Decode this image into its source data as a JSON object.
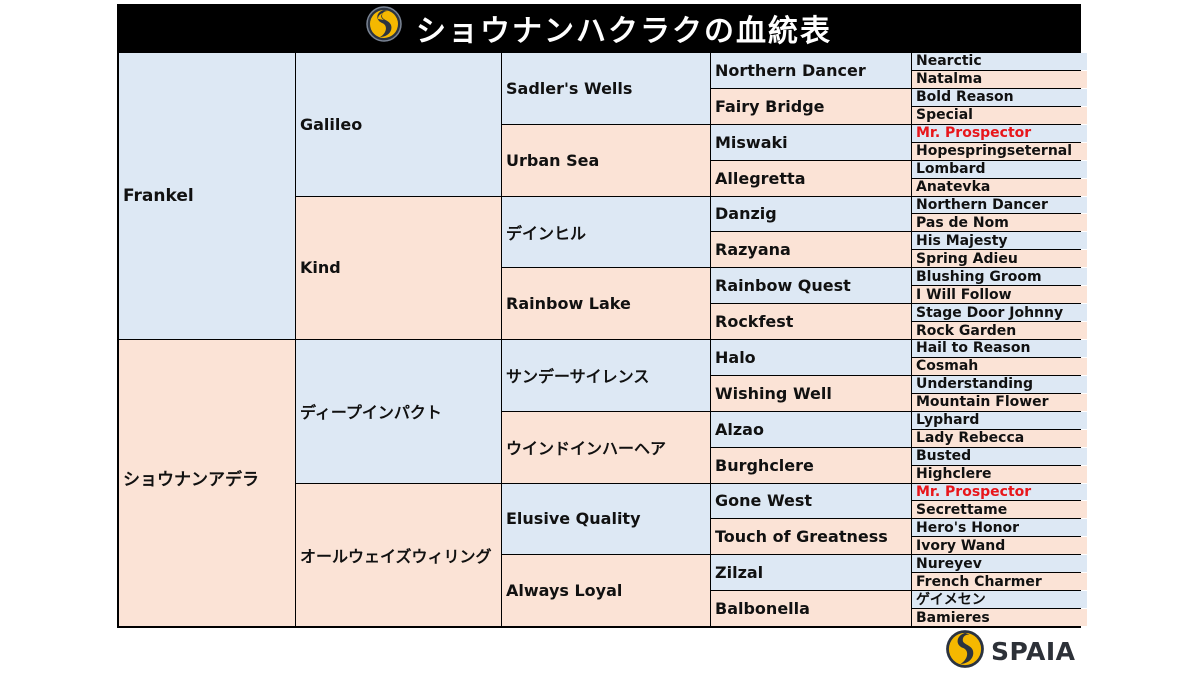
{
  "title": "ショウナンハクラクの血統表",
  "brand": {
    "name": "SPAIA",
    "logo_icon": "spaia-logo-icon"
  },
  "colors": {
    "sire_line": "#dde8f4",
    "dam_line": "#fbe3d6",
    "highlight": "#e8161b",
    "title_bg": "#000000"
  },
  "pedigree": {
    "gen1": [
      {
        "name": "Frankel",
        "side": "sire"
      },
      {
        "name": "ショウナンアデラ",
        "side": "dam"
      }
    ],
    "gen2": [
      {
        "name": "Galileo",
        "side": "sire"
      },
      {
        "name": "Kind",
        "side": "dam"
      },
      {
        "name": "ディープインパクト",
        "side": "sire"
      },
      {
        "name": "オールウェイズウィリング",
        "side": "dam"
      }
    ],
    "gen3": [
      {
        "name": "Sadler's Wells",
        "side": "sire"
      },
      {
        "name": "Urban Sea",
        "side": "dam"
      },
      {
        "name": "デインヒル",
        "side": "sire"
      },
      {
        "name": "Rainbow Lake",
        "side": "dam"
      },
      {
        "name": "サンデーサイレンス",
        "side": "sire"
      },
      {
        "name": "ウインドインハーヘア",
        "side": "dam"
      },
      {
        "name": "Elusive Quality",
        "side": "sire"
      },
      {
        "name": "Always Loyal",
        "side": "dam"
      }
    ],
    "gen4": [
      {
        "name": "Northern Dancer",
        "side": "sire"
      },
      {
        "name": "Fairy Bridge",
        "side": "dam"
      },
      {
        "name": "Miswaki",
        "side": "sire"
      },
      {
        "name": "Allegretta",
        "side": "dam"
      },
      {
        "name": "Danzig",
        "side": "sire"
      },
      {
        "name": "Razyana",
        "side": "dam"
      },
      {
        "name": "Rainbow Quest",
        "side": "sire"
      },
      {
        "name": "Rockfest",
        "side": "dam"
      },
      {
        "name": "Halo",
        "side": "sire"
      },
      {
        "name": "Wishing Well",
        "side": "dam"
      },
      {
        "name": "Alzao",
        "side": "sire"
      },
      {
        "name": "Burghclere",
        "side": "dam"
      },
      {
        "name": "Gone West",
        "side": "sire"
      },
      {
        "name": "Touch of Greatness",
        "side": "dam"
      },
      {
        "name": "Zilzal",
        "side": "sire"
      },
      {
        "name": "Balbonella",
        "side": "dam"
      }
    ],
    "gen5": [
      {
        "name": "Nearctic",
        "side": "sire",
        "highlight": false
      },
      {
        "name": "Natalma",
        "side": "dam",
        "highlight": false
      },
      {
        "name": "Bold Reason",
        "side": "sire",
        "highlight": false
      },
      {
        "name": "Special",
        "side": "dam",
        "highlight": false
      },
      {
        "name": "Mr. Prospector",
        "side": "sire",
        "highlight": true
      },
      {
        "name": "Hopespringseternal",
        "side": "dam",
        "highlight": false
      },
      {
        "name": "Lombard",
        "side": "sire",
        "highlight": false
      },
      {
        "name": "Anatevka",
        "side": "dam",
        "highlight": false
      },
      {
        "name": "Northern Dancer",
        "side": "sire",
        "highlight": false
      },
      {
        "name": "Pas de Nom",
        "side": "dam",
        "highlight": false
      },
      {
        "name": "His Majesty",
        "side": "sire",
        "highlight": false
      },
      {
        "name": "Spring Adieu",
        "side": "dam",
        "highlight": false
      },
      {
        "name": "Blushing Groom",
        "side": "sire",
        "highlight": false
      },
      {
        "name": "I Will Follow",
        "side": "dam",
        "highlight": false
      },
      {
        "name": "Stage Door Johnny",
        "side": "sire",
        "highlight": false
      },
      {
        "name": "Rock Garden",
        "side": "dam",
        "highlight": false
      },
      {
        "name": "Hail to Reason",
        "side": "sire",
        "highlight": false
      },
      {
        "name": "Cosmah",
        "side": "dam",
        "highlight": false
      },
      {
        "name": "Understanding",
        "side": "sire",
        "highlight": false
      },
      {
        "name": "Mountain Flower",
        "side": "dam",
        "highlight": false
      },
      {
        "name": "Lyphard",
        "side": "sire",
        "highlight": false
      },
      {
        "name": "Lady Rebecca",
        "side": "dam",
        "highlight": false
      },
      {
        "name": "Busted",
        "side": "sire",
        "highlight": false
      },
      {
        "name": "Highclere",
        "side": "dam",
        "highlight": false
      },
      {
        "name": "Mr. Prospector",
        "side": "sire",
        "highlight": true
      },
      {
        "name": "Secrettame",
        "side": "dam",
        "highlight": false
      },
      {
        "name": "Hero's Honor",
        "side": "sire",
        "highlight": false
      },
      {
        "name": "Ivory Wand",
        "side": "dam",
        "highlight": false
      },
      {
        "name": "Nureyev",
        "side": "sire",
        "highlight": false
      },
      {
        "name": "French Charmer",
        "side": "dam",
        "highlight": false
      },
      {
        "name": "ゲイメセン",
        "side": "sire",
        "highlight": false
      },
      {
        "name": "Bamieres",
        "side": "dam",
        "highlight": false
      }
    ]
  }
}
